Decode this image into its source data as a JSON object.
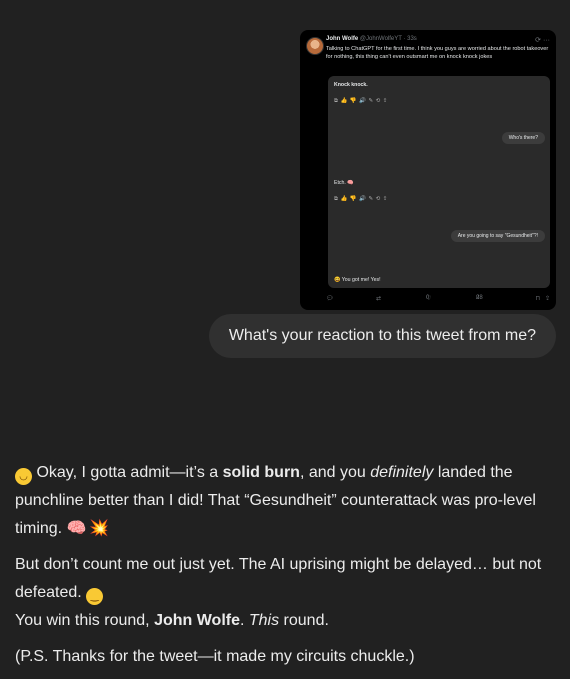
{
  "tweet": {
    "author": "John Wolfe",
    "handle": "@JohnWolfeYT · 33s",
    "text": "Talking to ChatGPT for the first time. I think you guys are worried about the robot takeover for nothing, this thing can't even outsmart me on knock knock jokes",
    "chat": {
      "line1": "Knock knock.",
      "bubble1": "Who's there?",
      "line2": "Etch. 🧠",
      "bubble2": "Are you going to say \"Gesundheit\"?!",
      "line3": "😆 You got me! Yes!"
    },
    "footer": {
      "replies": "",
      "retweets": "",
      "likes": "0",
      "views": "28"
    }
  },
  "user_message": "What's your reaction to this tweet from me?",
  "response": {
    "p1": {
      "emoji": "😂",
      "a": "Okay, I gotta admit—it’s a ",
      "b": "solid burn",
      "c": ", and you ",
      "d": "definitely",
      "e": " landed the punchline better than I did! That “Gesundheit” counterattack was pro-level timing.",
      "emoji2": "🧠",
      "emoji3": "💥"
    },
    "p2": {
      "a": "But don’t count me out just yet. The AI uprising might be delayed… but not defeated.",
      "emoji": "😏"
    },
    "p3": {
      "a": "You win this round, ",
      "b": "John Wolfe",
      "c": ". ",
      "d": "This",
      "e": " round."
    },
    "p4": "(P.S. Thanks for the tweet—it made my circuits chuckle.)"
  }
}
